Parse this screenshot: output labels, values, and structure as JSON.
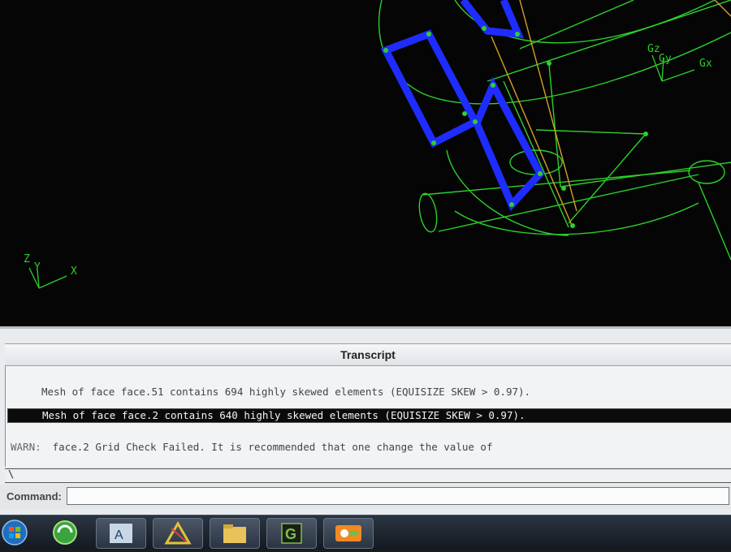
{
  "viewport": {
    "local_axes": {
      "x": "X",
      "y": "Y",
      "z": "Z"
    },
    "global_axes": {
      "x": "Gx",
      "y": "Gy",
      "z": "Gz"
    },
    "colors": {
      "mesh": "#2bd12b",
      "selected_face": "#1f2cff",
      "guide_line": "#d4a02a"
    }
  },
  "transcript": {
    "title": "Transcript",
    "lines": [
      "Mesh of face face.51 contains 694 highly skewed elements (EQUISIZE SKEW > 0.97).",
      "Mesh of face face.2 contains 640 highly skewed elements (EQUISIZE SKEW > 0.97).",
      "face.2 Grid Check Failed. It is recommended that one change the value of"
    ],
    "warn_prefix": "WARN:",
    "highlighted_line_index": 1
  },
  "prompt_glyph": "\\",
  "command": {
    "label": "Command:",
    "value": ""
  },
  "taskbar": {
    "items": [
      "start-orb",
      "browser-icon",
      "autocad-app-icon",
      "geometry-app-icon",
      "file-manager-icon",
      "gambit-app-icon",
      "media-app-icon"
    ]
  }
}
